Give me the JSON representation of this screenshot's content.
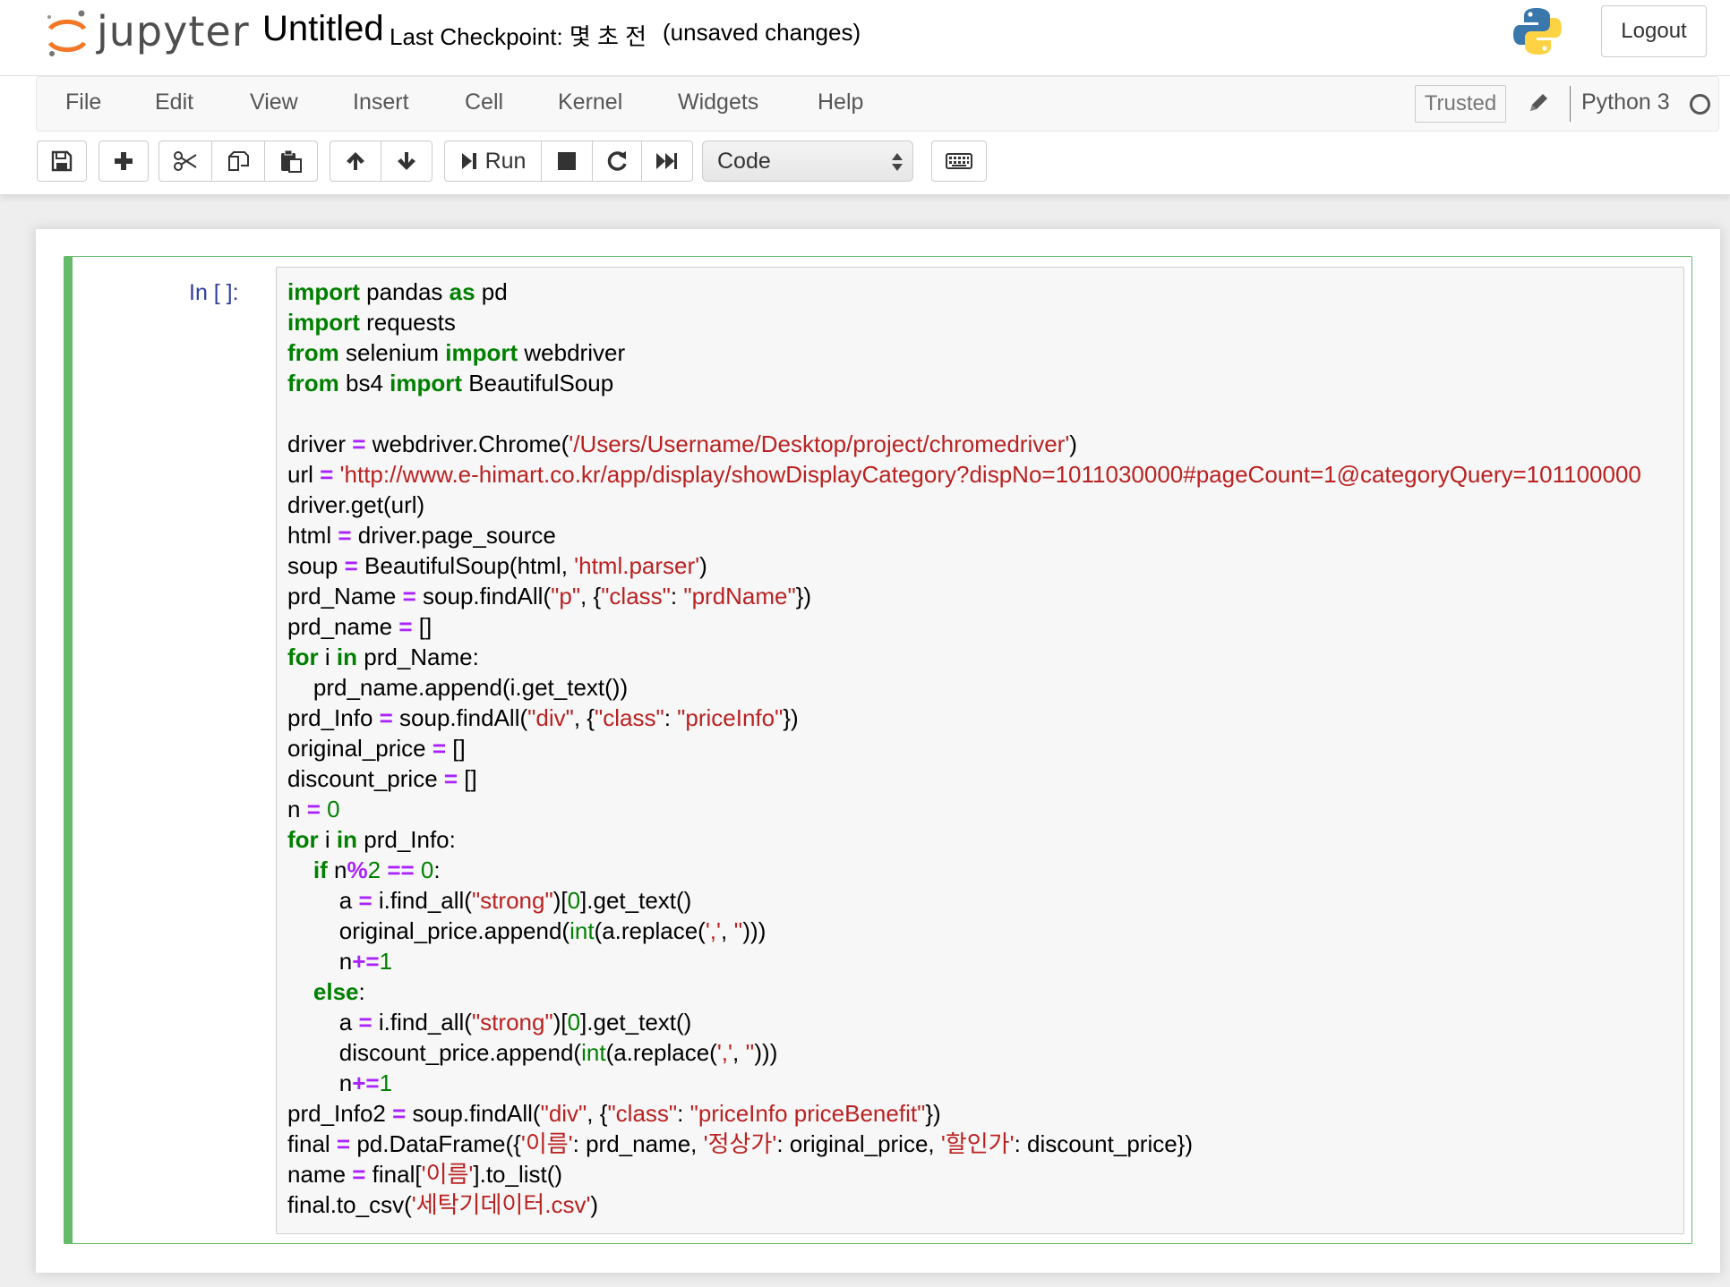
{
  "header": {
    "logo_text": "jupyter",
    "notebook_title": "Untitled",
    "checkpoint": "Last Checkpoint: 몇 초 전",
    "autosave_status": "(unsaved changes)",
    "logout_label": "Logout"
  },
  "menubar": {
    "items": [
      "File",
      "Edit",
      "View",
      "Insert",
      "Cell",
      "Kernel",
      "Widgets",
      "Help"
    ],
    "trusted_label": "Trusted",
    "kernel_name": "Python 3"
  },
  "toolbar": {
    "run_label": "Run",
    "cell_type": "Code",
    "buttons": [
      "save-icon",
      "plus-icon",
      "cut-icon",
      "copy-icon",
      "paste-icon",
      "arrow-up-icon",
      "arrow-down-icon",
      "run-icon",
      "stop-icon",
      "restart-icon",
      "fast-forward-icon",
      "keyboard-icon"
    ]
  },
  "cell": {
    "prompt": "In [ ]:",
    "code_lines": [
      "import pandas as pd",
      "import requests",
      "from selenium import webdriver",
      "from bs4 import BeautifulSoup",
      "",
      "driver = webdriver.Chrome('/Users/Username/Desktop/project/chromedriver')",
      "url = 'http://www.e-himart.co.kr/app/display/showDisplayCategory?dispNo=1011030000#pageCount=1@categoryQuery=101100000",
      "driver.get(url)",
      "html = driver.page_source",
      "soup = BeautifulSoup(html, 'html.parser')",
      "prd_Name = soup.findAll(\"p\", {\"class\": \"prdName\"})",
      "prd_name = []",
      "for i in prd_Name:",
      "    prd_name.append(i.get_text())",
      "prd_Info = soup.findAll(\"div\", {\"class\": \"priceInfo\"})",
      "original_price = []",
      "discount_price = []",
      "n = 0",
      "for i in prd_Info:",
      "    if n%2 == 0:",
      "        a = i.find_all(\"strong\")[0].get_text()",
      "        original_price.append(int(a.replace(',', '')))",
      "        n+=1",
      "    else:",
      "        a = i.find_all(\"strong\")[0].get_text()",
      "        discount_price.append(int(a.replace(',', '')))",
      "        n+=1",
      "prd_Info2 = soup.findAll(\"div\", {\"class\": \"priceInfo priceBenefit\"})",
      "final = pd.DataFrame({'이름': prd_name, '정상가': original_price, '할인가': discount_price})",
      "name = final['이름'].to_list()",
      "final.to_csv('세탁기데이터.csv')"
    ]
  },
  "colors": {
    "cell_border": "#66bb6a",
    "prompt": "#303f9f",
    "keyword": "#008000",
    "string": "#ba2121",
    "operator": "#aa22ff"
  }
}
